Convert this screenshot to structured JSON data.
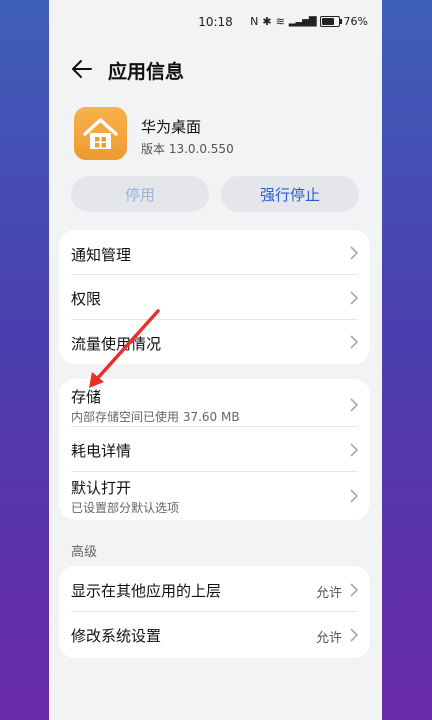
{
  "status_bar": {
    "time": "10:18",
    "battery": "76%"
  },
  "header": {
    "title": "应用信息"
  },
  "app": {
    "name": "华为桌面",
    "version": "版本 13.0.0.550"
  },
  "buttons": {
    "disable": "停用",
    "force_stop": "强行停止"
  },
  "group1": [
    {
      "label": "通知管理"
    },
    {
      "label": "权限"
    },
    {
      "label": "流量使用情况"
    }
  ],
  "group2": [
    {
      "label": "存储",
      "sub": "内部存储空间已使用 37.60 MB"
    },
    {
      "label": "耗电详情"
    },
    {
      "label": "默认打开",
      "sub": "已设置部分默认选项"
    }
  ],
  "advanced": {
    "section_label": "高级",
    "items": [
      {
        "label": "显示在其他应用的上层",
        "value": "允许"
      },
      {
        "label": "修改系统设置",
        "value": "允许"
      }
    ]
  },
  "colors": {
    "accent": "#2a5bd7",
    "annotation_arrow": "#e8302a",
    "app_icon": "#f2a53c"
  }
}
